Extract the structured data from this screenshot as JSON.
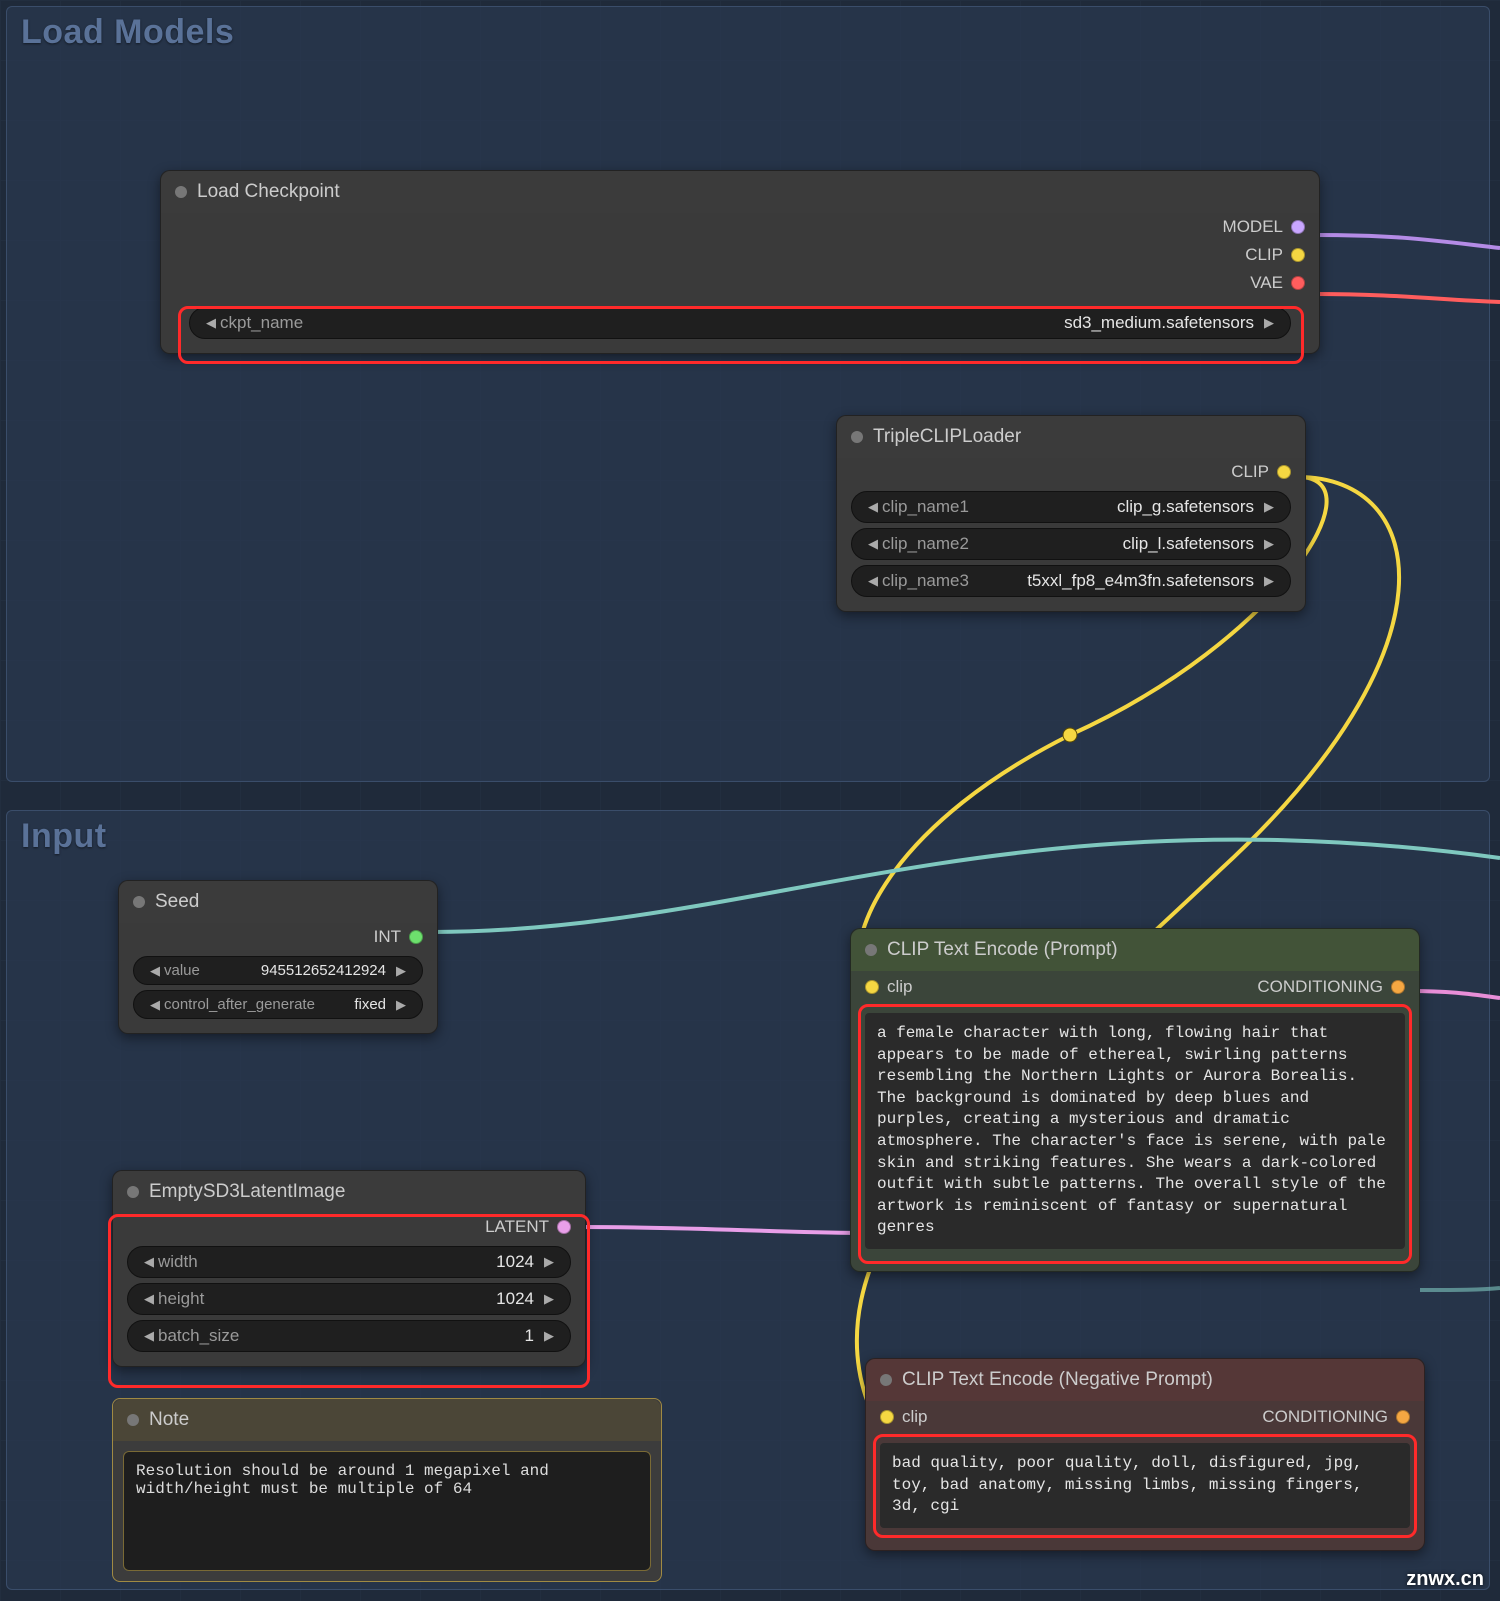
{
  "groups": {
    "load_models_title": "Load Models",
    "input_title": "Input"
  },
  "load_checkpoint": {
    "title": "Load Checkpoint",
    "outputs": {
      "model": "MODEL",
      "clip": "CLIP",
      "vae": "VAE"
    },
    "ckpt_name_label": "ckpt_name",
    "ckpt_name_value": "sd3_medium.safetensors"
  },
  "triple_clip": {
    "title": "TripleCLIPLoader",
    "output": "CLIP",
    "rows": [
      {
        "name": "clip_name1",
        "value": "clip_g.safetensors"
      },
      {
        "name": "clip_name2",
        "value": "clip_l.safetensors"
      },
      {
        "name": "clip_name3",
        "value": "t5xxl_fp8_e4m3fn.safetensors"
      }
    ]
  },
  "seed": {
    "title": "Seed",
    "output": "INT",
    "value_label": "value",
    "value": "945512652412924",
    "control_label": "control_after_generate",
    "control_value": "fixed"
  },
  "latent": {
    "title": "EmptySD3LatentImage",
    "output": "LATENT",
    "width_label": "width",
    "width_value": "1024",
    "height_label": "height",
    "height_value": "1024",
    "batch_label": "batch_size",
    "batch_value": "1"
  },
  "note": {
    "title": "Note",
    "text": "Resolution should be around 1 megapixel and width/height must be multiple of 64"
  },
  "positive": {
    "title": "CLIP Text Encode (Prompt)",
    "clip_label": "clip",
    "output": "CONDITIONING",
    "text": "a female character with long, flowing hair that appears to be made of ethereal, swirling patterns resembling the Northern Lights or Aurora Borealis. The background is dominated by deep blues and purples, creating a mysterious and dramatic atmosphere. The character's face is serene, with pale skin and striking features. She wears a dark-colored outfit with subtle patterns. The overall style of the artwork is reminiscent of fantasy or supernatural genres"
  },
  "negative": {
    "title": "CLIP Text Encode (Negative Prompt)",
    "clip_label": "clip",
    "output": "CONDITIONING",
    "text": "bad quality, poor quality, doll, disfigured, jpg, toy, bad anatomy, missing limbs, missing fingers, 3d, cgi"
  },
  "watermark": "znwx.cn"
}
